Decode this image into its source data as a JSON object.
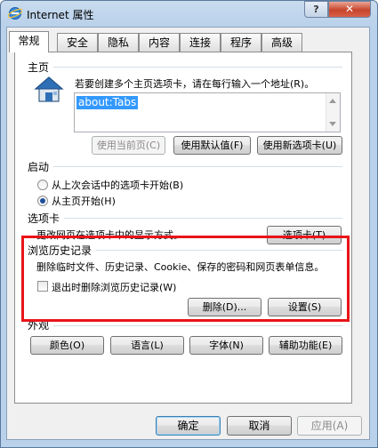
{
  "window": {
    "title": "Internet 属性",
    "help": "?",
    "close": "✕"
  },
  "tabs": [
    "常规",
    "安全",
    "隐私",
    "内容",
    "连接",
    "程序",
    "高级"
  ],
  "homepage": {
    "label": "主页",
    "description": "若要创建多个主页选项卡，请在每行输入一个地址(R)。",
    "value": "about:Tabs",
    "use_current": "使用当前页(C)",
    "use_default": "使用默认值(F)",
    "use_new_tab": "使用新选项卡(U)"
  },
  "startup": {
    "label": "启动",
    "option_last_session": "从上次会话中的选项卡开始(B)",
    "option_home": "从主页开始(H)",
    "selected": "option_home"
  },
  "tabs_group": {
    "label": "选项卡",
    "description": "更改网页在选项卡中的显示方式。",
    "button": "选项卡(T)"
  },
  "history": {
    "label": "浏览历史记录",
    "description": "删除临时文件、历史记录、Cookie、保存的密码和网页表单信息。",
    "checkbox": "退出时删除浏览历史记录(W)",
    "checked": false,
    "delete": "删除(D)...",
    "settings": "设置(S)"
  },
  "appearance": {
    "label": "外观",
    "colors": "颜色(O)",
    "languages": "语言(L)",
    "fonts": "字体(N)",
    "accessibility": "辅助功能(E)"
  },
  "footer": {
    "ok": "确定",
    "cancel": "取消",
    "apply": "应用(A)"
  },
  "colors": {
    "highlight_box": "#e8141a",
    "selection": "#3399ff",
    "titlebar": "#b9d1ea"
  }
}
